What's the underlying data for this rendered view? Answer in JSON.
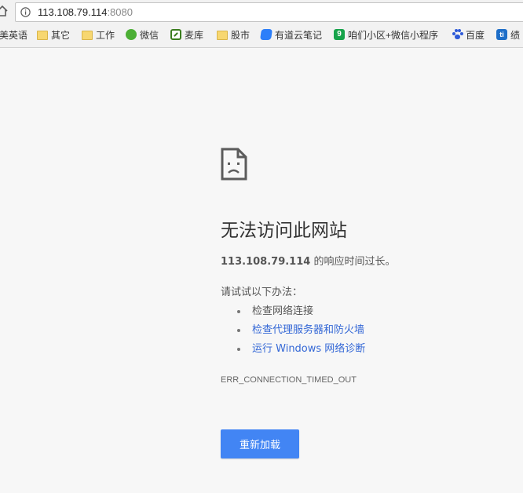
{
  "omnibox": {
    "host": "113.108.79.114",
    "port": ":8080"
  },
  "bookmarks": [
    {
      "label": "美英语",
      "icon": "english-icon"
    },
    {
      "label": "其它",
      "icon": "folder-icon"
    },
    {
      "label": "工作",
      "icon": "folder-icon"
    },
    {
      "label": "微信",
      "icon": "wechat-icon"
    },
    {
      "label": "麦库",
      "icon": "maiku-icon"
    },
    {
      "label": "股市",
      "icon": "folder-icon"
    },
    {
      "label": "有道云笔记",
      "icon": "youdao-note-icon"
    },
    {
      "label": "咱们小区+微信小程序",
      "icon": "community-icon"
    },
    {
      "label": "百度",
      "icon": "baidu-paw-icon"
    },
    {
      "label": "绩",
      "icon": "ti-icon"
    }
  ],
  "error": {
    "title": "无法访问此网站",
    "host": "113.108.79.114",
    "desc_suffix": " 的响应时间过长。",
    "suggest_head": "请试试以下办法：",
    "suggestions": [
      {
        "text": "检查网络连接",
        "link": false
      },
      {
        "text": "检查代理服务器和防火墙",
        "link": true
      },
      {
        "text": "运行 Windows 网络诊断",
        "link": true
      }
    ],
    "code": "ERR_CONNECTION_TIMED_OUT",
    "reload_label": "重新加载"
  },
  "colors": {
    "background": "#f7f7f7",
    "button": "#4285f4",
    "link": "#3367d6",
    "text": "#333333"
  }
}
